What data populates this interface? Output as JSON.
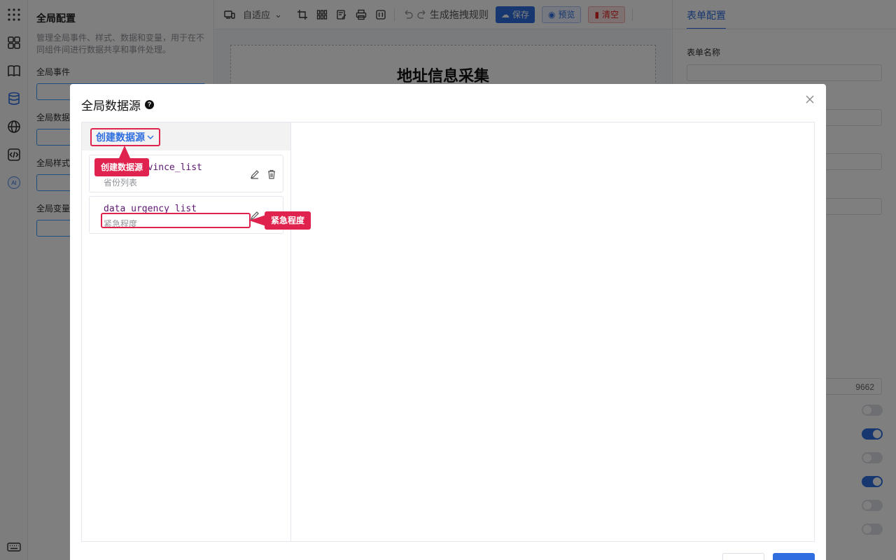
{
  "rail": {
    "icons": [
      "apps-grid-icon",
      "components-icon",
      "book-icon",
      "database-icon",
      "globe-icon",
      "code-icon",
      "ai-icon",
      "keyboard-icon"
    ],
    "ai_label": "AI"
  },
  "global_panel": {
    "title": "全局配置",
    "description": "管理全局事件、样式、数据和变量，用于在不同组件间进行数据共享和事件处理。",
    "sections": [
      "全局事件",
      "全局数据",
      "全局样式",
      "全局变量"
    ]
  },
  "toolbar": {
    "layout_select": "自适应",
    "rule_label": "生成拖拽规则",
    "save_label": "保存",
    "preview_label": "预览",
    "clear_label": "清空"
  },
  "canvas": {
    "form_title": "地址信息采集"
  },
  "right_panel": {
    "tab": "表单配置",
    "form_name_label": "表单名称",
    "partial_value": "9662",
    "toggles": [
      false,
      true,
      false,
      true,
      false,
      false
    ]
  },
  "dialog": {
    "title": "全局数据源",
    "help_icon": "?",
    "create_button": "创建数据源",
    "items": [
      {
        "name": "data_province_list",
        "desc": "省份列表"
      },
      {
        "name": "data_urgency_list",
        "desc": "紧急程度"
      }
    ],
    "annotations": {
      "create_tag": "创建数据源",
      "urgency_tag": "紧急程度",
      "province_name_partial": "vince_list",
      "province_desc_partial": "省份列表"
    }
  },
  "colors": {
    "accent": "#2f6fe0",
    "annotation": "#e0234e",
    "danger": "#e02020",
    "mono_text": "#5c1670"
  }
}
